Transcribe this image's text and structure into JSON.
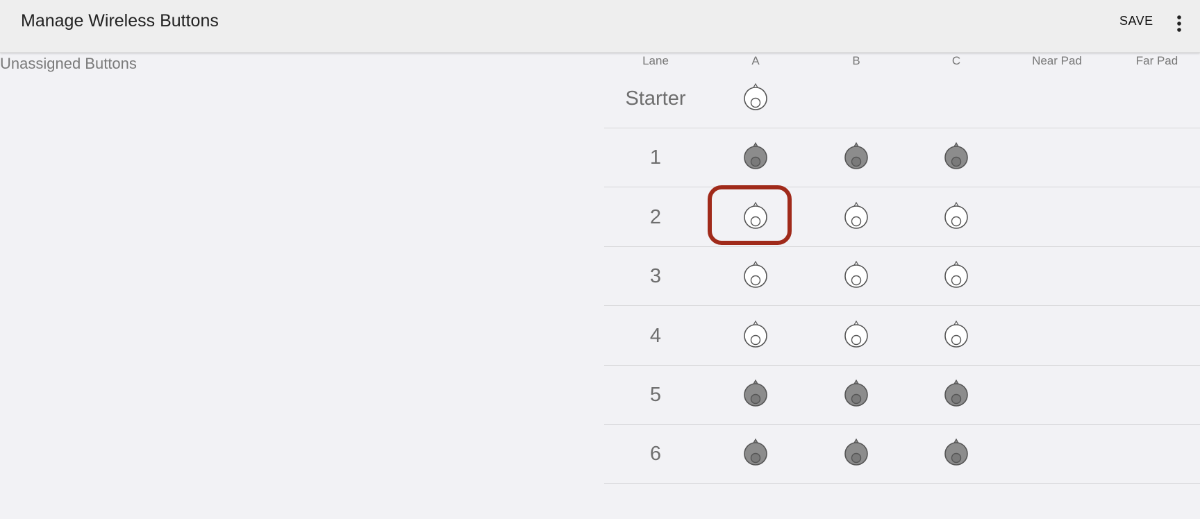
{
  "appbar": {
    "title": "Manage Wireless Buttons",
    "save_label": "SAVE",
    "more_icon": "more-vert-icon"
  },
  "left_panel": {
    "title": "Unassigned Buttons"
  },
  "table": {
    "columns": [
      "Lane",
      "A",
      "B",
      "C",
      "Near Pad",
      "Far Pad"
    ],
    "rows": [
      {
        "label": "Starter",
        "buttons": [
          "outline"
        ]
      },
      {
        "label": "1",
        "buttons": [
          "filled",
          "filled",
          "filled"
        ]
      },
      {
        "label": "2",
        "buttons": [
          "outline",
          "outline",
          "outline"
        ]
      },
      {
        "label": "3",
        "buttons": [
          "outline",
          "outline",
          "outline"
        ]
      },
      {
        "label": "4",
        "buttons": [
          "outline",
          "outline",
          "outline"
        ]
      },
      {
        "label": "5",
        "buttons": [
          "filled",
          "filled",
          "filled"
        ]
      },
      {
        "label": "6",
        "buttons": [
          "filled",
          "filled",
          "filled"
        ]
      }
    ],
    "highlighted_cell": {
      "row": "2",
      "column": "A"
    }
  },
  "colors": {
    "background": "#f2f2f5",
    "appbar": "#eeeeee",
    "button_filled": "#8c8c8c",
    "button_outline": "#ffffff",
    "highlight": "#a02a1a"
  }
}
